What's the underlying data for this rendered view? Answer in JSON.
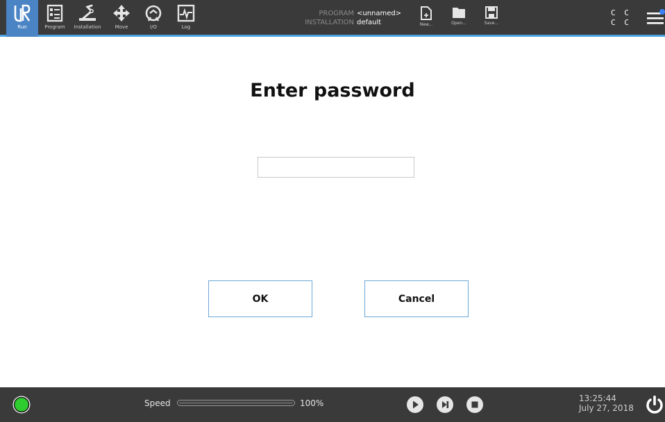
{
  "nav": {
    "items": [
      {
        "label": "Run",
        "icon": "ur-logo-icon"
      },
      {
        "label": "Program",
        "icon": "program-icon"
      },
      {
        "label": "Installation",
        "icon": "robot-arm-icon"
      },
      {
        "label": "Move",
        "icon": "move-arrows-icon"
      },
      {
        "label": "I/O",
        "icon": "io-gauge-icon"
      },
      {
        "label": "Log",
        "icon": "log-pulse-icon"
      }
    ],
    "active": "Run"
  },
  "program_info": {
    "program_key": "PROGRAM",
    "program_value": "<unnamed>",
    "installation_key": "INSTALLATION",
    "installation_value": "default"
  },
  "file_actions": {
    "new_label": "New...",
    "open_label": "Open...",
    "save_label": "Save..."
  },
  "mode_indicator": {
    "row1": "C C",
    "row2": "C C"
  },
  "dialog": {
    "title": "Enter password",
    "password_value": "",
    "ok_label": "OK",
    "cancel_label": "Cancel"
  },
  "footer": {
    "speed_label": "Speed",
    "speed_value": "100%",
    "speed_fraction": 1.0,
    "time": "13:25:44",
    "date": "July 27, 2018",
    "status_color": "#2ecc2e"
  },
  "colors": {
    "accent": "#4aa3df",
    "active_tab": "#4a84c4",
    "bar_bg": "#3a3a3a"
  }
}
